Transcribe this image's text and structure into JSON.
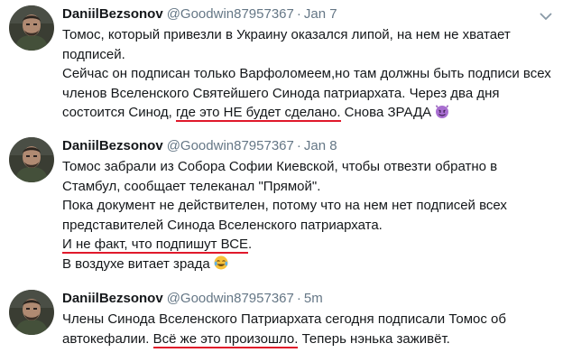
{
  "tweets": [
    {
      "name": "DaniilBezsonov",
      "handle": "@Goodwin87957367",
      "separator": "·",
      "time": "Jan 7",
      "emoji_icon": "smiling-devil-emoji",
      "lines": [
        {
          "parts": [
            {
              "text": "Томос, который привезли в Украину оказался липой, на нем не хватает"
            }
          ]
        },
        {
          "parts": [
            {
              "text": "подписей."
            }
          ]
        },
        {
          "parts": [
            {
              "text": "Сейчас он подписан только Варфоломеем,но там должны быть подписи всех"
            }
          ]
        },
        {
          "parts": [
            {
              "text": "членов Вселенского Святейшего Синода патриархата. Через два дня"
            }
          ]
        },
        {
          "parts": [
            {
              "text": "состоится Синод, "
            },
            {
              "text": "где это НЕ будет сделано.",
              "underline": true
            },
            {
              "text": " Снова ЗРАДА"
            }
          ]
        }
      ]
    },
    {
      "name": "DaniilBezsonov",
      "handle": "@Goodwin87957367",
      "separator": "·",
      "time": "Jan 8",
      "emoji_icon": "tears-of-joy-emoji",
      "lines": [
        {
          "parts": [
            {
              "text": "Томос забрали из Собора Софии Киевской, чтобы отвезти обратно в"
            }
          ]
        },
        {
          "parts": [
            {
              "text": "Стамбул, сообщает телеканал \"Прямой\"."
            }
          ]
        },
        {
          "parts": [
            {
              "text": "Пока документ не действителен, потому что на нем нет подписей всех"
            }
          ]
        },
        {
          "parts": [
            {
              "text": "представителей Синода Вселенского патриархата."
            }
          ]
        },
        {
          "parts": [
            {
              "text": "И не факт, что подпишут ВСЕ",
              "underline": true
            },
            {
              "text": "."
            }
          ]
        },
        {
          "parts": [
            {
              "text": "В воздухе витает зрада"
            }
          ]
        }
      ]
    },
    {
      "name": "DaniilBezsonov",
      "handle": "@Goodwin87957367",
      "separator": "·",
      "time": "5m",
      "lines": [
        {
          "parts": [
            {
              "text": "Члены Синода Вселенского Патриархата сегодня подписали Томос об"
            }
          ]
        },
        {
          "parts": [
            {
              "text": "автокефалии. "
            },
            {
              "text": "Всё же это произошло.",
              "underline": true
            },
            {
              "text": " Теперь нэнька заживёт."
            }
          ]
        }
      ]
    }
  ],
  "colors": {
    "text": "#14171a",
    "secondary": "#657786",
    "underline": "#e0192b"
  }
}
